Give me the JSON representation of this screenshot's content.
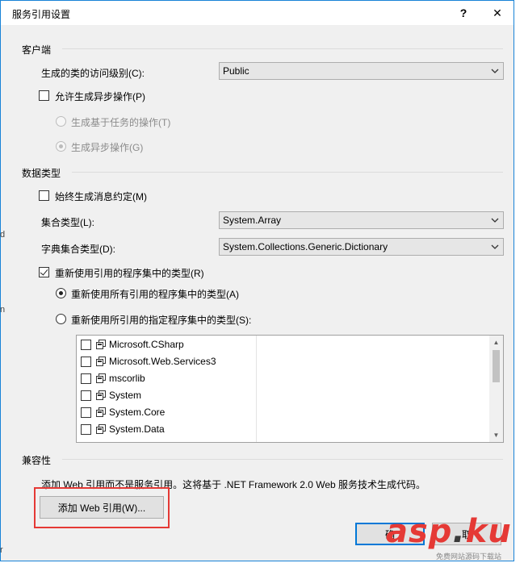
{
  "window": {
    "title": "服务引用设置",
    "help_label": "?",
    "close_label": "✕"
  },
  "client": {
    "header": "客户端",
    "access_label": "生成的类的访问级别(C):",
    "access_value": "Public",
    "async_label": "允许生成异步操作(P)",
    "task_label": "生成基于任务的操作(T)",
    "async_ops_label": "生成异步操作(G)"
  },
  "data_type": {
    "header": "数据类型",
    "message_contract_label": "始终生成消息约定(M)",
    "collection_label": "集合类型(L):",
    "collection_value": "System.Array",
    "dictionary_label": "字典集合类型(D):",
    "dictionary_value": "System.Collections.Generic.Dictionary",
    "reuse_label": "重新使用引用的程序集中的类型(R)",
    "reuse_all_label": "重新使用所有引用的程序集中的类型(A)",
    "reuse_specified_label": "重新使用所引用的指定程序集中的类型(S):",
    "assemblies": [
      {
        "name": "Microsoft.CSharp",
        "checked": false
      },
      {
        "name": "Microsoft.Web.Services3",
        "checked": false
      },
      {
        "name": "mscorlib",
        "checked": false
      },
      {
        "name": "System",
        "checked": false
      },
      {
        "name": "System.Core",
        "checked": false
      },
      {
        "name": "System.Data",
        "checked": false
      }
    ]
  },
  "compat": {
    "header": "兼容性",
    "description": "添加 Web 引用而不是服务引用。这将基于 .NET Framework 2.0 Web 服务技术生成代码。",
    "add_web_ref_label": "添加 Web 引用(W)..."
  },
  "footer": {
    "ok_label": "确",
    "cancel_label": "取"
  },
  "watermark": {
    "part1": "asp",
    "part2": "ku",
    "dot": ".",
    "sub": "免费网站源码下载站"
  },
  "side_fragments": [
    "d",
    "n",
    "r"
  ],
  "colors": {
    "accent": "#0078d7",
    "highlight": "#e53935"
  }
}
